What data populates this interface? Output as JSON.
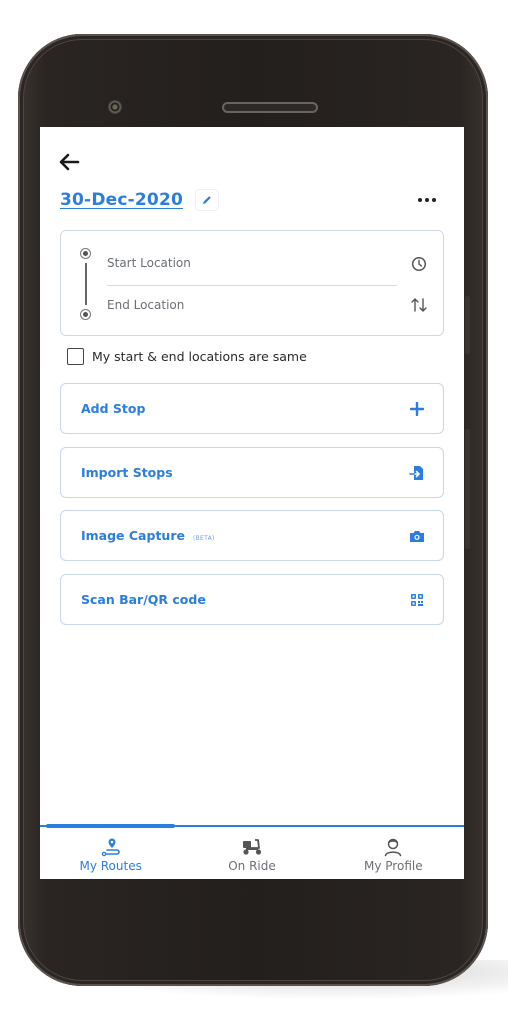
{
  "colors": {
    "accent": "#2b7de0",
    "text_primary": "#2a2a2a",
    "text_muted": "#6b6f75",
    "card_border": "#c7d7e8",
    "phone_body": "#231f1d"
  },
  "header": {
    "back_icon": "arrow-left-icon",
    "date": "30-Dec-2020",
    "edit_icon": "pencil-icon",
    "more_icon": "more-horizontal-icon"
  },
  "locations": {
    "start_placeholder": "Start Location",
    "start_value": "",
    "end_placeholder": "End Location",
    "end_value": "",
    "time_icon": "clock-icon",
    "swap_icon": "swap-vertical-icon"
  },
  "same_location": {
    "label": "My start & end locations are same",
    "checked": false
  },
  "actions": [
    {
      "label": "Add Stop",
      "badge": "",
      "icon": "plus-icon"
    },
    {
      "label": "Import Stops",
      "badge": "",
      "icon": "file-import-icon"
    },
    {
      "label": "Image Capture",
      "badge": "(BETA)",
      "icon": "camera-icon"
    },
    {
      "label": "Scan Bar/QR code",
      "badge": "",
      "icon": "qr-code-icon"
    }
  ],
  "bottom_nav": {
    "active_index": 0,
    "items": [
      {
        "label": "My Routes",
        "icon": "route-pin-icon"
      },
      {
        "label": "On Ride",
        "icon": "scooter-icon"
      },
      {
        "label": "My Profile",
        "icon": "user-icon"
      }
    ]
  }
}
